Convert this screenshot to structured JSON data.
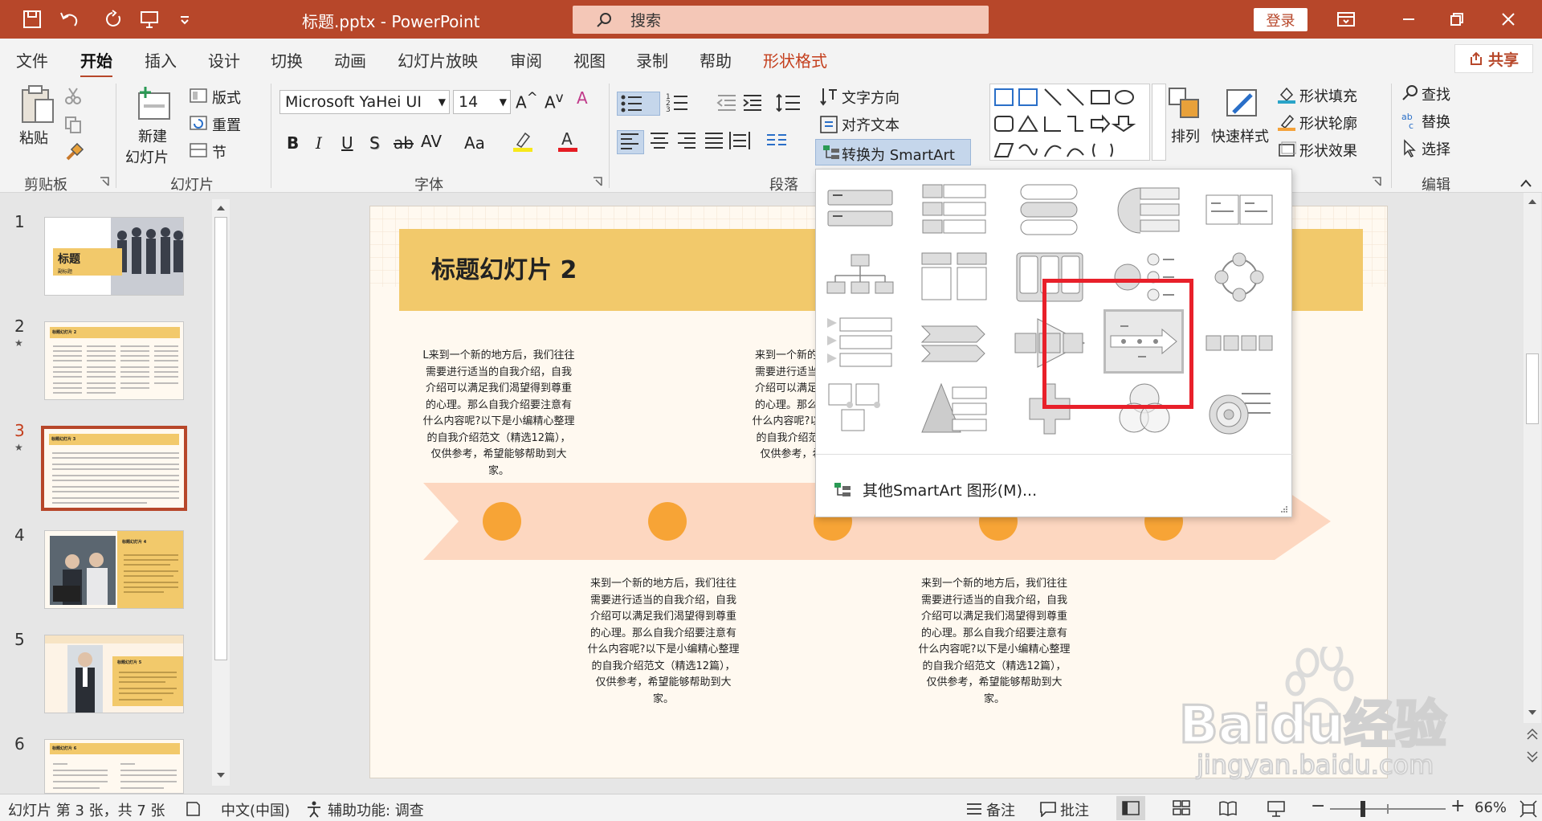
{
  "window": {
    "title": "标题.pptx  -  PowerPoint",
    "search_placeholder": "搜索",
    "login_label": "登录",
    "share_label": "共享"
  },
  "tabs": [
    "文件",
    "开始",
    "插入",
    "设计",
    "切换",
    "动画",
    "幻灯片放映",
    "审阅",
    "视图",
    "录制",
    "帮助",
    "形状格式"
  ],
  "ribbon": {
    "clipboard": {
      "paste": "粘贴",
      "group": "剪贴板"
    },
    "slides": {
      "new_slide_1": "新建",
      "new_slide_2": "幻灯片",
      "layout": "版式",
      "reset": "重置",
      "section": "节",
      "group": "幻灯片"
    },
    "font": {
      "name": "Microsoft YaHei UI",
      "size": "14",
      "bold": "B",
      "italic": "I",
      "underline": "U",
      "shadow": "S",
      "strike": "ab",
      "spacing": "AV",
      "case": "Aa",
      "group": "字体"
    },
    "paragraph": {
      "text_direction": "文字方向",
      "align_text": "对齐文本",
      "convert_smartart": "转换为 SmartArt",
      "group": "段落"
    },
    "drawing": {
      "arrange": "排列",
      "quick_styles": "快速样式",
      "fill": "形状填充",
      "outline": "形状轮廓",
      "effects": "形状效果"
    },
    "editing": {
      "find": "查找",
      "replace": "替换",
      "select": "选择",
      "group": "编辑"
    }
  },
  "thumbnails": [
    {
      "num": "1",
      "title": "标题",
      "subtitle": "副标题"
    },
    {
      "num": "2",
      "title": "标题幻灯片 2"
    },
    {
      "num": "3",
      "title": "标题幻灯片 3"
    },
    {
      "num": "4",
      "title": "标题幻灯片 4"
    },
    {
      "num": "5",
      "title": "标题幻灯片 5"
    },
    {
      "num": "6",
      "title": "标题幻灯片 6"
    }
  ],
  "slide": {
    "title": "标题幻灯片 2",
    "para_a": "L来到一个新的地方后，我们往往需要进行适当的自我介绍，自我介绍可以满足我们渴望得到尊重的心理。那么自我介绍要注意有什么内容呢?以下是小编精心整理的自我介绍范文（精选12篇），仅供参考，希望能够帮助到大家。",
    "para_b": "来到一个新的地方后，我们往往需要进行适当的自我介绍，自我介绍可以满足我们渴望得到尊重的心理。那么自我介绍要注意有什么内容呢?以下是小编精心整理的自我介绍范文（精选12篇），仅供参考，希望能够帮助到大家。"
  },
  "gallery": {
    "more_label": "其他SmartArt 图形(M)..."
  },
  "statusbar": {
    "slide_info": "幻灯片 第 3 张，共 7 张",
    "language": "中文(中国)",
    "accessibility": "辅助功能: 调查",
    "notes": "备注",
    "comments": "批注",
    "zoom": "66%"
  },
  "watermark": {
    "brand": "Baidu经验",
    "url": "jingyan.baidu.com"
  },
  "colors": {
    "accent": "#b7472a",
    "slide_title_bar": "#f2c96b",
    "timeline_circle": "#f7a436",
    "highlight_box": "#e8202a"
  }
}
